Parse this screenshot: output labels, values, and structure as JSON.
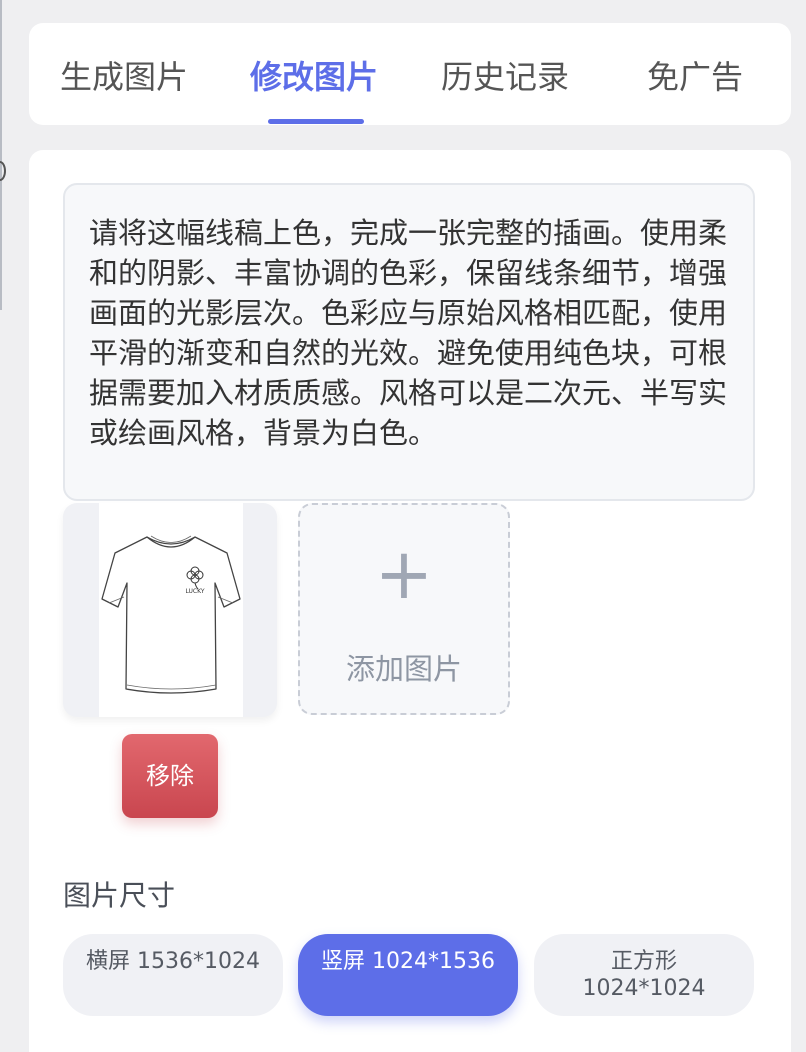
{
  "tabs": [
    {
      "label": "生成图片",
      "active": false
    },
    {
      "label": "修改图片",
      "active": true
    },
    {
      "label": "历史记录",
      "active": false
    },
    {
      "label": "免广告",
      "active": false
    }
  ],
  "prompt": {
    "text": "请将这幅线稿上色，完成一张完整的插画。使用柔和的阴影、丰富协调的色彩，保留线条细节，增强画面的光影层次。色彩应与原始风格相匹配，使用平滑的渐变和自然的光效。避免使用纯色块，可根据需要加入材质质感。风格可以是二次元、半写实或绘画风格，背景为白色。"
  },
  "uploaded_image": {
    "print_text": "LUCKY",
    "remove_label": "移除"
  },
  "add_image": {
    "label": "添加图片",
    "icon": "plus-icon"
  },
  "size": {
    "title": "图片尺寸",
    "options": [
      {
        "label": "横屏 1536*1024",
        "active": false
      },
      {
        "label": "竖屏 1024*1536",
        "active": true
      },
      {
        "label": "正方形\n1024*1024",
        "active": false
      }
    ]
  },
  "colors": {
    "accent": "#5d6ee8",
    "danger": "#d9535c",
    "background": "#efeff1"
  }
}
